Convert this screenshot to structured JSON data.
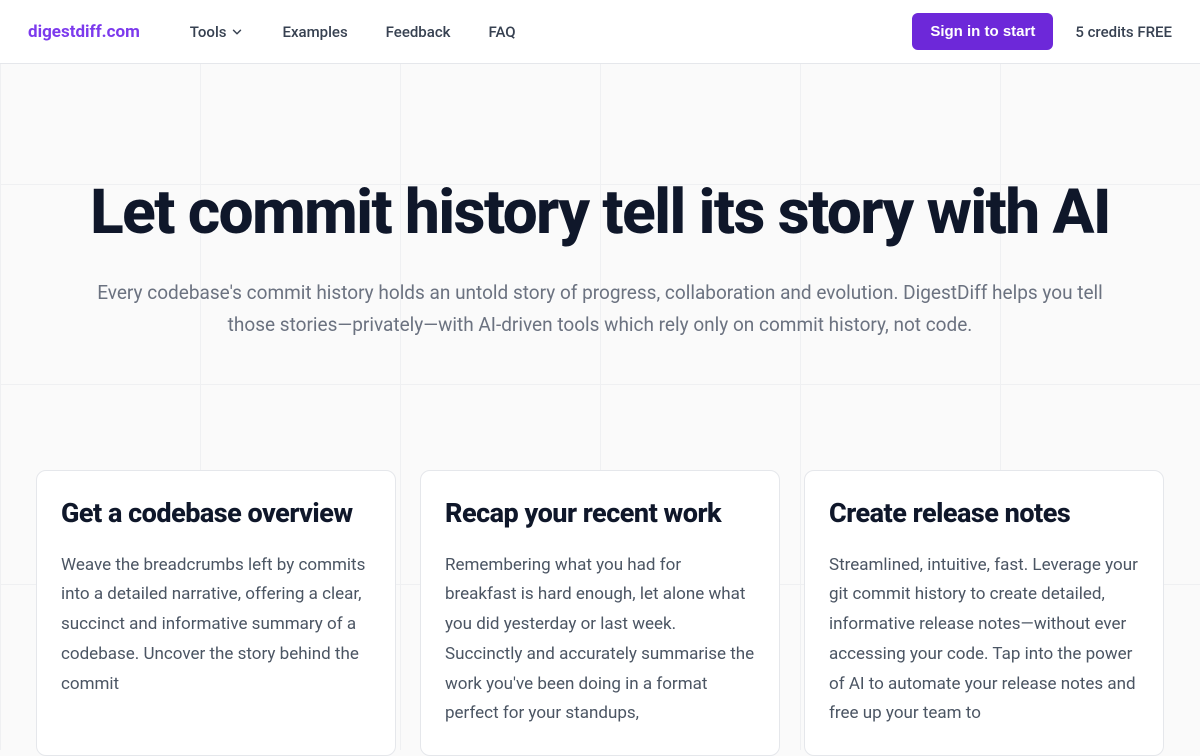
{
  "header": {
    "logo": "digestdiff.com",
    "nav": {
      "tools": "Tools",
      "examples": "Examples",
      "feedback": "Feedback",
      "faq": "FAQ"
    },
    "signin_label": "Sign in to start",
    "credits_label": "5 credits FREE"
  },
  "hero": {
    "title": "Let commit history tell its story with AI",
    "subtitle": "Every codebase's commit history holds an untold story of progress, collaboration and evolution. DigestDiff helps you tell those stories—privately—with AI-driven tools which rely only on commit history, not code."
  },
  "features": [
    {
      "title": "Get a codebase overview",
      "text": "Weave the breadcrumbs left by commits into a detailed narrative, offering a clear, succinct and informative summary of a codebase. Uncover the story behind the commit"
    },
    {
      "title": "Recap your recent work",
      "text": "Remembering what you had for breakfast is hard enough, let alone what you did yesterday or last week. Succinctly and accurately summarise the work you've been doing in a format perfect for your standups,"
    },
    {
      "title": "Create release notes",
      "text": "Streamlined, intuitive, fast. Leverage your git commit history to create detailed, informative release notes—without ever accessing your code. Tap into the power of AI to automate your release notes and free up your team to"
    }
  ],
  "colors": {
    "brand": "#7c3aed",
    "button": "#6d28d9"
  }
}
